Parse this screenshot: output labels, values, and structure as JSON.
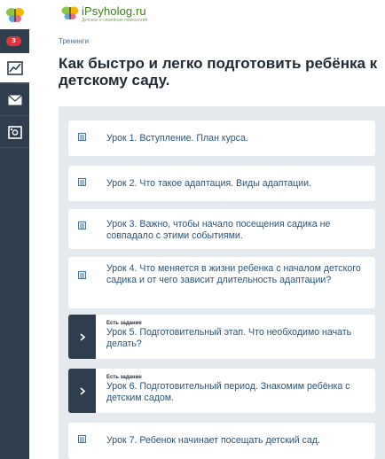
{
  "sidebar": {
    "badge_count": "3",
    "items": [
      {
        "icon": "chart-icon",
        "active": true
      },
      {
        "icon": "mail-icon",
        "active": false
      },
      {
        "icon": "safe-icon",
        "active": false
      }
    ]
  },
  "header": {
    "logo_name": "iPsyholog.ru",
    "logo_tagline": "Детская и семейная психология"
  },
  "breadcrumb": "Тренинги",
  "page_title": "Как быстро и легко подготовить ребёнка к детскому саду.",
  "lessons": [
    {
      "tag": "",
      "title": "Урок 1. Вступление. План курса."
    },
    {
      "tag": "",
      "title": "Урок 2. Что такое адаптация. Виды адаптации."
    },
    {
      "tag": "",
      "title": "Урок 3. Важно, чтобы начало посещения садика не совпадало с этими событиями."
    },
    {
      "tag": "",
      "title": "Урок 4. Что меняется в жизни ребенка с началом детского садика и от чего зависит длительность адаптации?"
    },
    {
      "tag": "Есть задание",
      "title": "Урок 5. Подготовительный этап. Что необходимо начать делать?"
    },
    {
      "tag": "Есть задание",
      "title": "Урок 6. Подготовительный период. Знакомим ребёнка с детским садом."
    },
    {
      "tag": "",
      "title": "Урок 7. Ребенок начинает посещать детский сад."
    }
  ],
  "colors": {
    "sidebar_bg": "#2e3e4e",
    "panel_bg": "#e5eaee",
    "link": "#2a5578",
    "badge": "#e0353b",
    "logo_green": "#3f7d1f"
  }
}
